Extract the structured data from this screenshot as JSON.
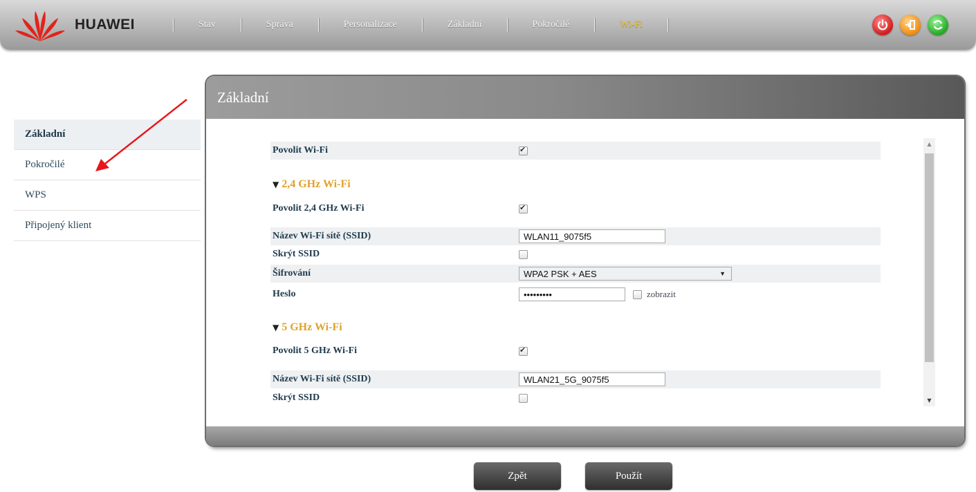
{
  "header": {
    "brand": "HUAWEI",
    "nav": [
      {
        "label": "Stav"
      },
      {
        "label": "Správa"
      },
      {
        "label": "Personalizace"
      },
      {
        "label": "Základní"
      },
      {
        "label": "Pokročilé"
      },
      {
        "label": "Wi-Fi",
        "active": true
      }
    ],
    "icons": [
      "power-icon",
      "logout-icon",
      "refresh-icon"
    ]
  },
  "sidebar": {
    "items": [
      {
        "label": "Základní",
        "active": true
      },
      {
        "label": "Pokročilé"
      },
      {
        "label": "WPS"
      },
      {
        "label": "Připojený klient"
      }
    ]
  },
  "panel": {
    "title": "Základní",
    "enable_wifi": {
      "label": "Povolit Wi-Fi",
      "checked": true
    },
    "band24": {
      "title": "2,4 GHz Wi-Fi",
      "enable": {
        "label": "Povolit 2,4 GHz Wi-Fi",
        "checked": true
      },
      "ssid": {
        "label": "Název Wi-Fi sítě (SSID)",
        "value": "WLAN11_9075f5"
      },
      "hide_ssid": {
        "label": "Skrýt SSID",
        "checked": false
      },
      "encryption": {
        "label": "Šifrování",
        "value": "WPA2 PSK + AES"
      },
      "password": {
        "label": "Heslo",
        "value": "•••••••••",
        "show_label": "zobrazit"
      }
    },
    "band5": {
      "title": "5 GHz Wi-Fi",
      "enable": {
        "label": "Povolit 5 GHz Wi-Fi",
        "checked": true
      },
      "ssid": {
        "label": "Název Wi-Fi sítě (SSID)",
        "value": "WLAN21_5G_9075f5"
      },
      "hide_ssid": {
        "label": "Skrýt SSID",
        "checked": false
      }
    }
  },
  "buttons": {
    "back": "Zpět",
    "apply": "Použít"
  },
  "colors": {
    "accent": "#f1c21b",
    "section_title": "#e0a22a",
    "arrow": "#e8161b"
  }
}
